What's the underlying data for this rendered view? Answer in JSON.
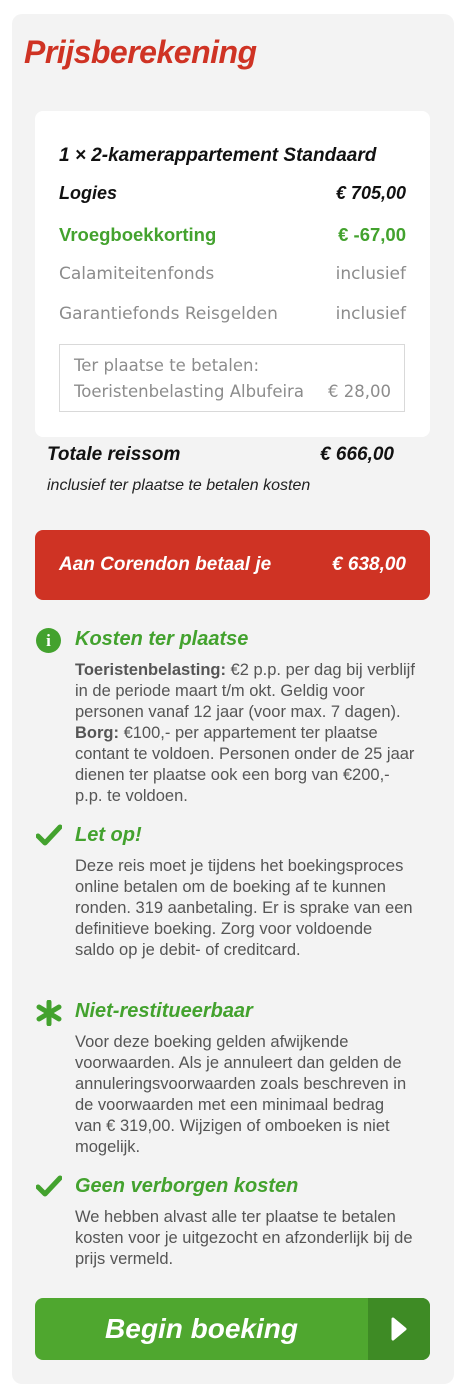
{
  "title": "Prijsberekening",
  "card": {
    "heading": "1 × 2-kamerappartement Standaard",
    "rows": [
      {
        "label": "Logies",
        "value": "€ 705,00"
      },
      {
        "label": "Vroegboekkorting",
        "value": "€ -67,00"
      },
      {
        "label": "Calamiteitenfonds",
        "value": "inclusief"
      },
      {
        "label": "Garantiefonds Reisgelden",
        "value": "inclusief"
      }
    ],
    "local": {
      "line1": "Ter plaatse te betalen:",
      "item": "Toeristenbelasting Albufeira",
      "amount": "€ 28,00"
    }
  },
  "total": {
    "label": "Totale reissom",
    "value": "€ 666,00",
    "note": "inclusief ter plaatse te betalen kosten"
  },
  "pay": {
    "label": "Aan Corendon betaal je",
    "value": "€ 638,00"
  },
  "info": [
    {
      "icon": "info-circle-icon",
      "heading": "Kosten ter plaatse",
      "b1": "Toeristenbelasting:",
      "t1": " €2 p.p. per dag bij verblijf in de periode maart t/m okt. Geldig voor personen vanaf 12 jaar (voor max. 7 dagen). ",
      "b2": "Borg:",
      "t2": " €100,- per appartement ter plaatse contant te voldoen. Personen onder de 25 jaar dienen ter plaatse ook een borg van €200,- p.p. te voldoen."
    },
    {
      "icon": "checkmark-icon",
      "heading": "Let op!",
      "text": "Deze reis moet je tijdens het boekingsproces online betalen om de boeking af te kunnen ronden. 319 aanbetaling. Er is sprake van een definitieve boeking. Zorg voor voldoende saldo op je debit- of creditcard."
    },
    {
      "icon": "asterisk-icon",
      "heading": "Niet-restitueerbaar",
      "text": "Voor deze boeking gelden afwijkende voorwaarden. Als je annuleert dan gelden de annuleringsvoorwaarden zoals beschreven in de voorwaarden met een minimaal bedrag van € 319,00. Wijzigen of omboeken is niet mogelijk."
    },
    {
      "icon": "checkmark-icon",
      "heading": "Geen verborgen kosten",
      "text": "We hebben alvast alle ter plaatse te betalen kosten voor je uitgezocht en afzonderlijk bij de prijs vermeld."
    }
  ],
  "cta": {
    "label": "Begin boeking",
    "icon": "play-arrow-icon"
  },
  "colors": {
    "brand_red": "#cf3324",
    "green": "#43a22e",
    "cta_green": "#4fa72f",
    "cta_dark_green": "#3e8b25"
  }
}
